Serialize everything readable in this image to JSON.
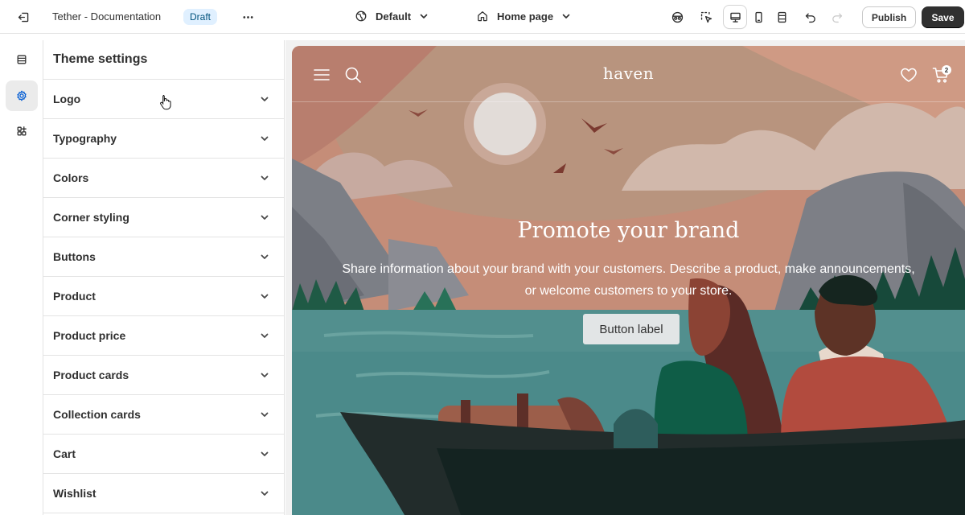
{
  "topbar": {
    "app_title": "Tether - Documentation",
    "status_badge": "Draft",
    "theme_selector": "Default",
    "page_selector": "Home page",
    "publish_label": "Publish",
    "save_label": "Save"
  },
  "rail": {
    "items": [
      "sections-icon",
      "theme-settings-icon",
      "apps-icon"
    ],
    "active": "theme-settings-icon"
  },
  "panel": {
    "title": "Theme settings",
    "sections": [
      {
        "label": "Logo"
      },
      {
        "label": "Typography"
      },
      {
        "label": "Colors"
      },
      {
        "label": "Corner styling"
      },
      {
        "label": "Buttons"
      },
      {
        "label": "Product"
      },
      {
        "label": "Product price"
      },
      {
        "label": "Product cards"
      },
      {
        "label": "Collection cards"
      },
      {
        "label": "Cart"
      },
      {
        "label": "Wishlist"
      }
    ]
  },
  "preview": {
    "store_logo": "haven",
    "cart_count": "2",
    "hero_title": "Promote your brand",
    "hero_subtitle": "Share information about your brand with your customers. Describe a product, make announcements, or welcome customers to your store.",
    "hero_button": "Button label"
  },
  "colors": {
    "save_button": "#303030",
    "active_icon": "#005bd3",
    "draft_badge_bg": "#e0f0ff"
  }
}
